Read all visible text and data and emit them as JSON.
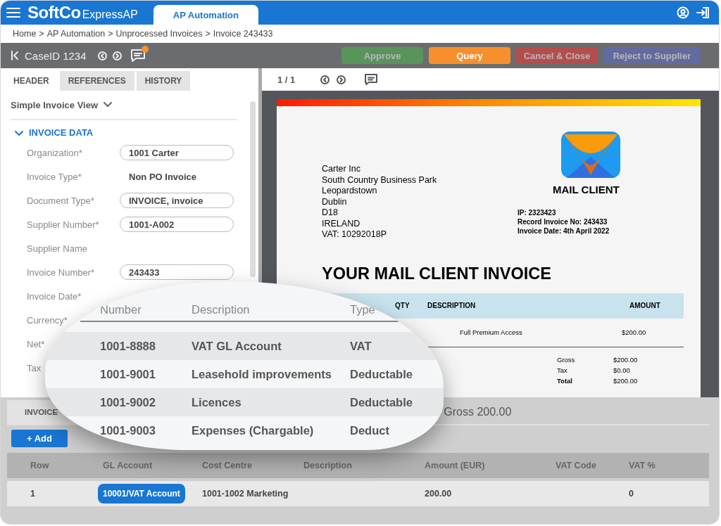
{
  "app_bar": {
    "brand": "SoftCo",
    "product": "ExpressAP",
    "tabs": [
      {
        "label": "AP Automation",
        "selected": true
      }
    ]
  },
  "breadcrumb": {
    "items": [
      "Home",
      "AP Automation",
      "Unprocessed Invoices",
      "Invoice 243433"
    ],
    "separator": ">"
  },
  "case_bar": {
    "case_id": "CaseID 1234",
    "has_new_comments": true,
    "actions": [
      {
        "label": "Approve",
        "kind": "approve",
        "disabled": true
      },
      {
        "label": "Query",
        "kind": "query",
        "disabled": false
      },
      {
        "label": "Cancel & Close",
        "kind": "cancel",
        "disabled": true
      },
      {
        "label": "Reject to Supplier",
        "kind": "reject",
        "disabled": true
      }
    ]
  },
  "header_panel": {
    "tabs": [
      {
        "label": "HEADER",
        "selected": true
      },
      {
        "label": "REFERENCES",
        "selected": false
      },
      {
        "label": "HISTORY",
        "selected": false
      }
    ],
    "view": "Simple Invoice View",
    "section": {
      "title": "INVOICE DATA",
      "expanded": true
    },
    "fields": [
      {
        "label": "Organization*",
        "value": "1001 Carter",
        "kind": "input"
      },
      {
        "label": "Invoice Type*",
        "value": "Non PO Invoice",
        "kind": "text"
      },
      {
        "label": "Document Type*",
        "value": "INVOICE, invoice",
        "kind": "input"
      },
      {
        "label": "Supplier Number*",
        "value": "1001-A002",
        "kind": "input"
      },
      {
        "label": "Supplier Name",
        "kind": "text"
      },
      {
        "label": "Invoice Number*",
        "value": "243433",
        "kind": "input"
      },
      {
        "label": "Invoice Date*",
        "kind": "text"
      },
      {
        "label": "Currency*",
        "kind": "text"
      },
      {
        "label": "Net*",
        "kind": "text"
      },
      {
        "label": "Tax",
        "kind": "text"
      }
    ]
  },
  "document_viewer": {
    "page": "1 / 1",
    "invoice": {
      "sender_lines": [
        "Carter Inc",
        "South Country Business Park",
        "Leopardstown",
        "Dublin",
        "D18",
        "IRELAND",
        "VAT: 10292018P"
      ],
      "brand": "MAIL CLIENT",
      "meta_lines": [
        "IP: 2323423",
        "Record Invoice No: 243433",
        "Invoice Date: 4th April 2022"
      ],
      "title": "YOUR MAIL CLIENT INVOICE",
      "columns": [
        "QTY",
        "DESCRIPTION",
        "AMOUNT"
      ],
      "items": [
        {
          "description": "Full Premium Access",
          "amount": "$200.00"
        }
      ],
      "totals": [
        {
          "label": "Gross",
          "value": "$200.00",
          "bold": false
        },
        {
          "label": "Tax",
          "value": "$0.00",
          "bold": false
        },
        {
          "label": "Total",
          "value": "$200.00",
          "bold": true
        }
      ]
    }
  },
  "lines_panel": {
    "tabs": [
      {
        "label": "INVOICE",
        "selected": true
      }
    ],
    "summary": "Gross 200.00",
    "add_label": "+ Add",
    "columns": [
      "Row",
      "GL Account",
      "Cost Centre",
      "Description",
      "Amount (EUR)",
      "VAT Code",
      "VAT %"
    ],
    "rows": [
      {
        "row": "1",
        "gl_account": "10001/VAT Account",
        "cost_centre": "1001-1002 Marketing",
        "amount": "200.00",
        "vat_percent": "0"
      }
    ]
  },
  "magnifier": {
    "columns": [
      "Number",
      "Description",
      "Type"
    ],
    "rows": [
      {
        "number": "1001-8888",
        "description": "VAT GL Account",
        "type": "VAT"
      },
      {
        "number": "1001-9001",
        "description": "Leasehold improvements",
        "type": "Deductable"
      },
      {
        "number": "1001-9002",
        "description": "Licences",
        "type": "Deductable"
      },
      {
        "number": "1001-9003",
        "description": "Expenses (Chargable)",
        "type": "Deduct"
      }
    ]
  }
}
